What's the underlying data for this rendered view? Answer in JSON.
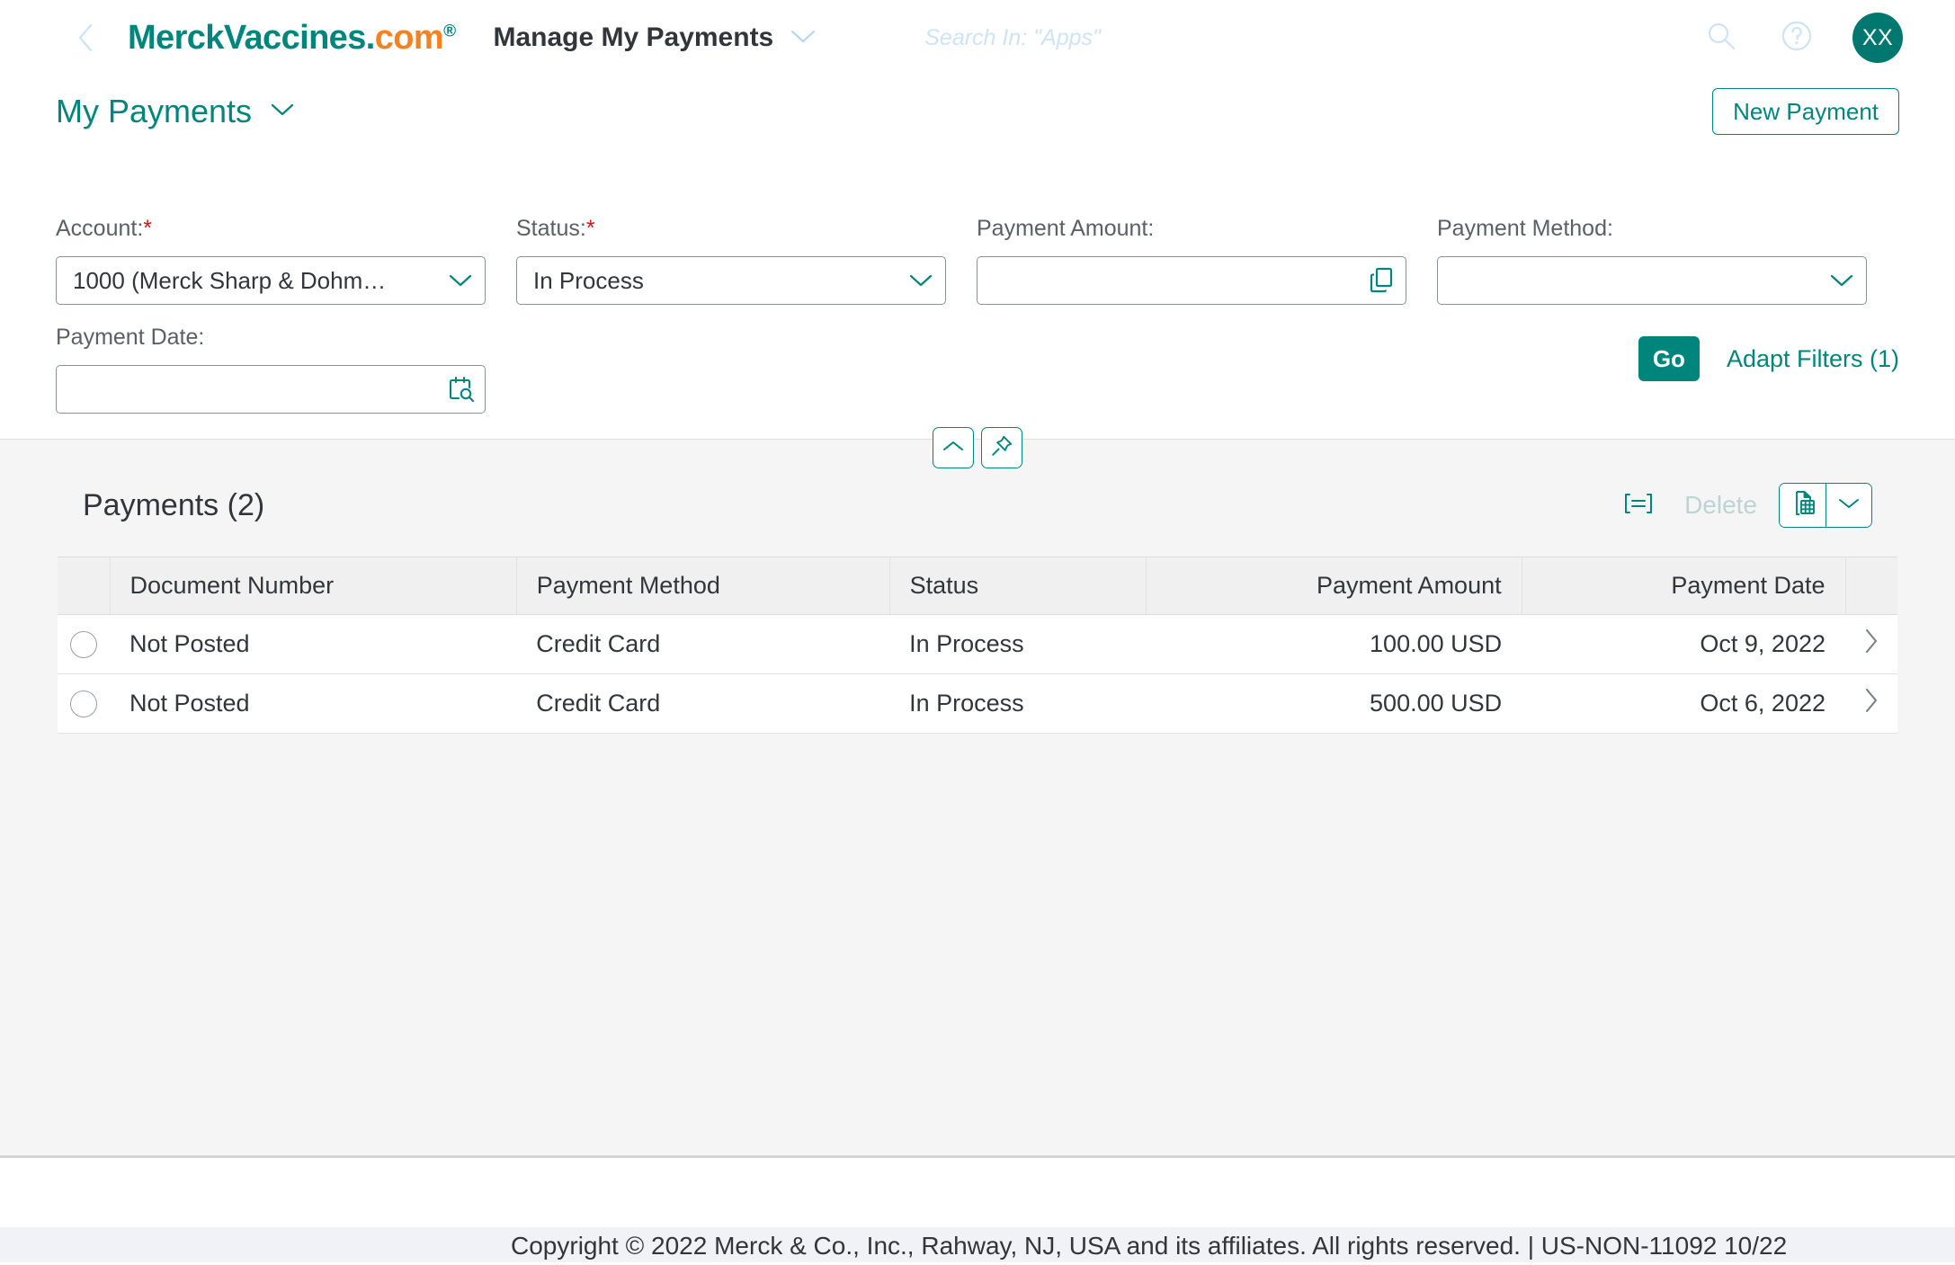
{
  "shell": {
    "back_icon": "chevron-left-icon",
    "brand": {
      "merck": "Merck",
      "vaccines": "Vaccines",
      "dot": ".",
      "com": "com",
      "registered": "®"
    },
    "app_title": "Manage My Payments",
    "app_title_chevron_icon": "chevron-down-icon",
    "search_placeholder": "Search In: \"Apps\"",
    "search_icon": "search-icon",
    "help_icon": "question-mark-circle-icon",
    "avatar_initials": "XX"
  },
  "page": {
    "title": "My Payments",
    "title_chevron_icon": "chevron-down-icon",
    "new_payment_label": "New Payment"
  },
  "filters": {
    "fields": [
      {
        "label": "Account:",
        "required": true,
        "value": "1000 (Merck Sharp & Dohm…",
        "placeholder": "",
        "icon": "chevron-down-icon",
        "type": "select"
      },
      {
        "label": "Status:",
        "required": true,
        "value": "In Process",
        "placeholder": "",
        "icon": "chevron-down-icon",
        "type": "select"
      },
      {
        "label": "Payment Amount:",
        "required": false,
        "value": "",
        "placeholder": "",
        "icon": "multi-value-help-icon",
        "type": "input"
      },
      {
        "label": "Payment Method:",
        "required": false,
        "value": "",
        "placeholder": "",
        "icon": "chevron-down-icon",
        "type": "select"
      },
      {
        "label": "Payment Date:",
        "required": false,
        "value": "",
        "placeholder": "",
        "icon": "calendar-search-icon",
        "type": "daterange"
      }
    ],
    "go_label": "Go",
    "adapt_filters_label": "Adapt Filters (1)",
    "required_marker": "*",
    "collapse_icon": "chevron-up-icon",
    "pin_icon": "pin-icon"
  },
  "table": {
    "title": "Payments (2)",
    "personalize_icon": "table-settings-icon",
    "delete_label": "Delete",
    "delete_enabled": false,
    "export_icon": "excel-export-icon",
    "export_arrow_icon": "chevron-down-icon",
    "columns": [
      "Document Number",
      "Payment Method",
      "Status",
      "Payment Amount",
      "Payment Date"
    ],
    "rows": [
      {
        "document_number": "Not Posted",
        "payment_method": "Credit Card",
        "status": "In Process",
        "payment_amount": "100.00 USD",
        "payment_date": "Oct 9, 2022",
        "selected": false,
        "nav_icon": "chevron-right-icon"
      },
      {
        "document_number": "Not Posted",
        "payment_method": "Credit Card",
        "status": "In Process",
        "payment_amount": "500.00 USD",
        "payment_date": "Oct 6, 2022",
        "selected": false,
        "nav_icon": "chevron-right-icon"
      }
    ]
  },
  "footer": {
    "copyright": "Copyright © 2022 Merck & Co., Inc., Rahway, NJ, USA and its affiliates. All rights reserved. | US-NON-11092 10/22"
  },
  "colors": {
    "brand_teal": "#00857c",
    "brand_orange": "#f58220",
    "required_red": "#cc1919",
    "text_dark": "#32363a",
    "muted": "#5a6066",
    "content_bg": "#f5f5f5"
  }
}
